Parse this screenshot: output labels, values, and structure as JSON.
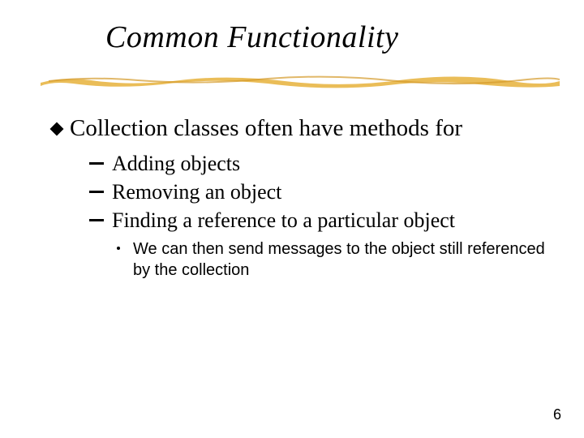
{
  "slide": {
    "title": "Common Functionality",
    "bullet_main": "Collection classes often have methods for",
    "sub_bullets": [
      "Adding objects",
      "Removing an object",
      "Finding a reference to a particular object"
    ],
    "sub_sub_bullet": "We can then send messages to the object still referenced by the collection",
    "page_number": "6"
  }
}
